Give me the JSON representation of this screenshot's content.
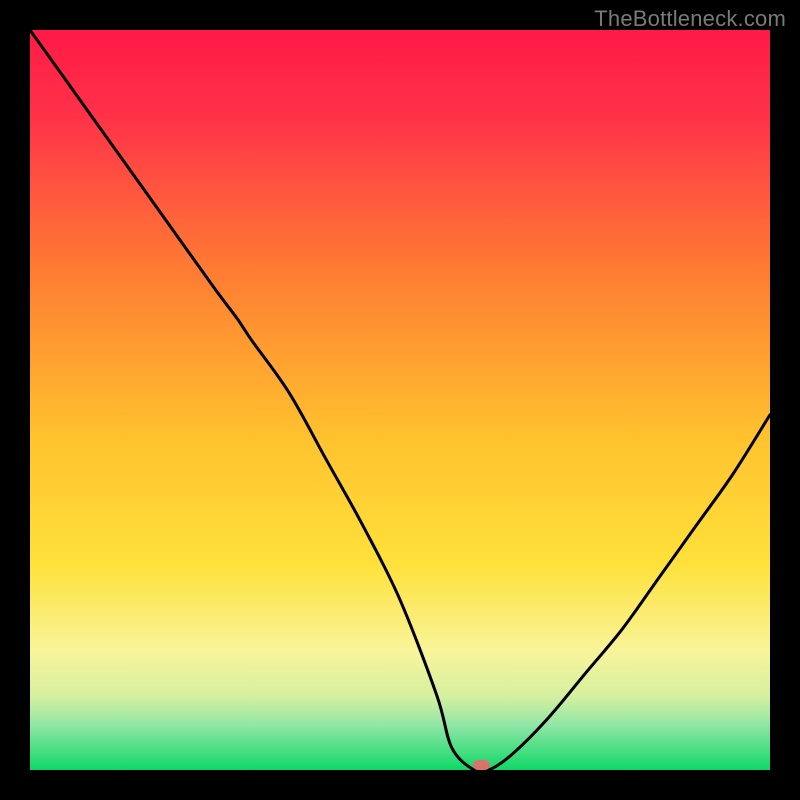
{
  "attribution": "TheBottleneck.com",
  "colors": {
    "bg_black": "#000000",
    "red_top": "#ff1a47",
    "orange": "#ff8a2a",
    "yellow": "#ffe13a",
    "pale_yellow": "#faf7a0",
    "mint": "#a7ecb8",
    "green_bottom": "#0fd867",
    "curve": "#000000",
    "marker": "#d9726b",
    "attribution_text": "#7a7a7a"
  },
  "chart_data": {
    "type": "line",
    "title": "",
    "xlabel": "",
    "ylabel": "",
    "xlim": [
      0,
      100
    ],
    "ylim": [
      0,
      100
    ],
    "grid": false,
    "legend": false,
    "x": [
      0,
      5,
      10,
      15,
      20,
      25,
      28,
      30,
      35,
      40,
      45,
      50,
      55,
      57,
      60,
      62,
      65,
      70,
      75,
      80,
      85,
      90,
      95,
      100
    ],
    "y": [
      100,
      93,
      86,
      79,
      72,
      65,
      61,
      58,
      51,
      42,
      33,
      23,
      10,
      3,
      0,
      0,
      2,
      7,
      13,
      19,
      26,
      33,
      40,
      48
    ],
    "marker": {
      "x": 61,
      "y": 0,
      "w": 2.4,
      "h": 1.4
    },
    "gradient_stops": [
      {
        "pct": 0,
        "color": "#ff1a47"
      },
      {
        "pct": 12,
        "color": "#ff3348"
      },
      {
        "pct": 32,
        "color": "#ff7a33"
      },
      {
        "pct": 55,
        "color": "#ffc22e"
      },
      {
        "pct": 72,
        "color": "#ffe13a"
      },
      {
        "pct": 84,
        "color": "#f8f49a"
      },
      {
        "pct": 90,
        "color": "#d6f0a0"
      },
      {
        "pct": 94,
        "color": "#8fe6a6"
      },
      {
        "pct": 100,
        "color": "#0fd867"
      }
    ]
  }
}
